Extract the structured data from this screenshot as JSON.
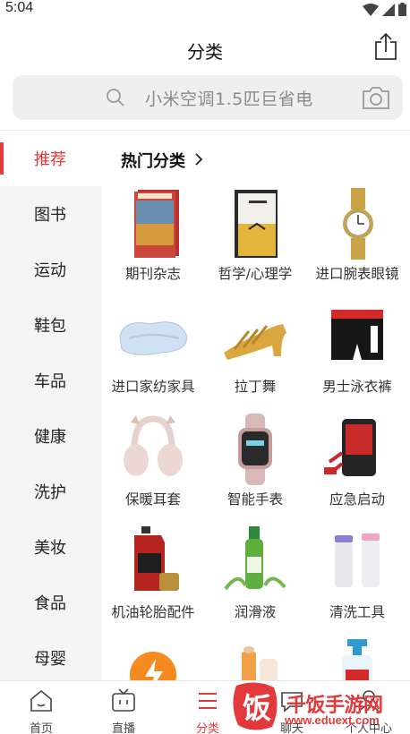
{
  "status_bar": {
    "time": "5:04",
    "icons": [
      "wifi-icon",
      "signal-icon",
      "battery-icon"
    ]
  },
  "header": {
    "title": "分类",
    "share_icon": "share-icon"
  },
  "search": {
    "placeholder": "小米空调1.5匹巨省电",
    "icon": "search-icon",
    "camera_icon": "camera-icon"
  },
  "sidebar": {
    "items": [
      {
        "label": "推荐",
        "active": true
      },
      {
        "label": "图书"
      },
      {
        "label": "运动"
      },
      {
        "label": "鞋包"
      },
      {
        "label": "车品"
      },
      {
        "label": "健康"
      },
      {
        "label": "洗护"
      },
      {
        "label": "美妆"
      },
      {
        "label": "食品"
      },
      {
        "label": "母婴"
      }
    ]
  },
  "content": {
    "section_title": "热门分类",
    "tiles": [
      {
        "label": "期刊杂志",
        "icon": "magazine-image"
      },
      {
        "label": "哲学/心理学",
        "icon": "book-image"
      },
      {
        "label": "进口腕表眼镜",
        "icon": "watch-image"
      },
      {
        "label": "进口家纺家具",
        "icon": "pillow-image"
      },
      {
        "label": "拉丁舞",
        "icon": "dance-shoe-image"
      },
      {
        "label": "男士泳衣裤",
        "icon": "swim-trunks-image"
      },
      {
        "label": "保暖耳套",
        "icon": "earmuff-image"
      },
      {
        "label": "智能手表",
        "icon": "smartwatch-image"
      },
      {
        "label": "应急启动",
        "icon": "jump-starter-image"
      },
      {
        "label": "机油轮胎配件",
        "icon": "engine-oil-image"
      },
      {
        "label": "润滑液",
        "icon": "lubricant-bottle-image"
      },
      {
        "label": "清洗工具",
        "icon": "cleaning-cup-image"
      },
      {
        "label": "",
        "icon": "flash-badge-image"
      },
      {
        "label": "",
        "icon": "cosmetics-image"
      },
      {
        "label": "",
        "icon": "hand-wash-image"
      }
    ]
  },
  "tabbar": {
    "tabs": [
      {
        "label": "首页",
        "icon": "home-icon"
      },
      {
        "label": "直播",
        "icon": "tv-icon"
      },
      {
        "label": "分类",
        "icon": "category-list-icon",
        "active": true
      },
      {
        "label": "聊天",
        "icon": "chat-icon"
      },
      {
        "label": "个人中心",
        "icon": "user-icon"
      }
    ]
  },
  "watermark": {
    "text": "千饭手游网",
    "url": "www.eduext.com",
    "logo": "饭"
  },
  "colors": {
    "accent": "#e4393c",
    "sidebar_bg": "#f5f5f5",
    "search_bg": "#efefef"
  }
}
